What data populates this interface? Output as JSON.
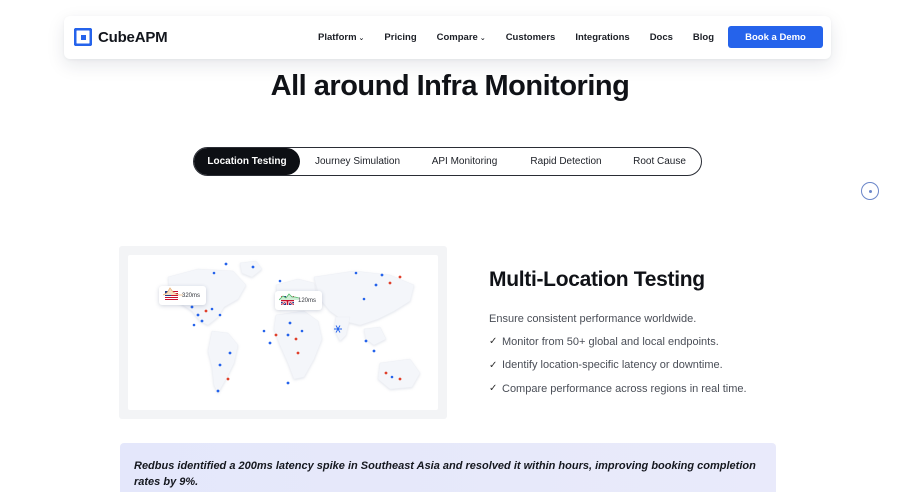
{
  "brand": {
    "name": "CubeAPM",
    "logo_icon": "cube-logo-icon",
    "accent": "#2563eb"
  },
  "nav": {
    "links": [
      {
        "label": "Platform",
        "has_dropdown": true
      },
      {
        "label": "Pricing",
        "has_dropdown": false
      },
      {
        "label": "Compare",
        "has_dropdown": true
      },
      {
        "label": "Customers",
        "has_dropdown": false
      },
      {
        "label": "Integrations",
        "has_dropdown": false
      },
      {
        "label": "Docs",
        "has_dropdown": false
      },
      {
        "label": "Blog",
        "has_dropdown": false
      }
    ],
    "dropdown_glyph": "⌄",
    "cta_label": "Book a Demo"
  },
  "hero": {
    "title": "All around Infra Monitoring"
  },
  "tabs": {
    "items": [
      "Location Testing",
      "Journey Simulation",
      "API Monitoring",
      "Rapid Detection",
      "Root Cause"
    ],
    "active_index": 0
  },
  "map": {
    "bubbles": [
      {
        "flag": "us-flag-icon",
        "value": "320ms",
        "trend_color": "#e8b27a"
      },
      {
        "flag": "uk-flag-icon",
        "value": "120ms",
        "trend_color": "#52b96a"
      }
    ],
    "dot_colors": {
      "primary": "#2563eb",
      "alert": "#e0402b"
    },
    "snowflake_icon": "snowflake-icon"
  },
  "feature": {
    "title": "Multi-Location Testing",
    "subtitle": "Ensure consistent performance worldwide.",
    "bullets": [
      "Monitor from 50+ global and local endpoints.",
      "Identify location-specific latency or downtime.",
      "Compare performance across regions in real time."
    ],
    "bullet_icon": "check-icon"
  },
  "quote": {
    "text": "Redbus identified a 200ms latency spike in Southeast Asia and resolved it within hours, improving booking completion rates by 9%."
  }
}
